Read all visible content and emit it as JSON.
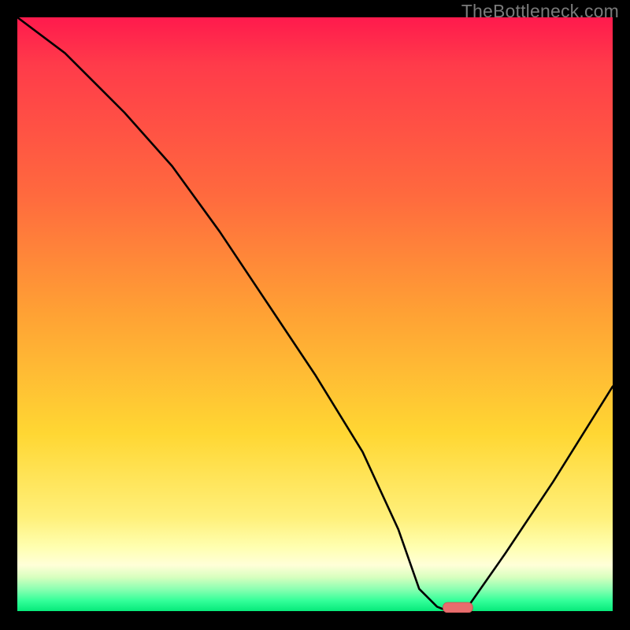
{
  "watermark": "TheBottleneck.com",
  "chart_data": {
    "type": "line",
    "title": "",
    "xlabel": "",
    "ylabel": "",
    "xlim": [
      0,
      100
    ],
    "ylim": [
      0,
      100
    ],
    "grid": false,
    "legend": false,
    "series": [
      {
        "name": "bottleneck-curve",
        "x": [
          0,
          8,
          18,
          26,
          34,
          42,
          50,
          58,
          64,
          67.5,
          70.5,
          73,
          75,
          82,
          90,
          100
        ],
        "values": [
          100,
          94,
          84,
          75,
          64,
          52,
          40,
          27,
          14,
          4,
          1,
          0,
          0,
          10,
          22,
          38
        ]
      }
    ],
    "marker": {
      "name": "optimal-marker",
      "x": 74,
      "y": 0,
      "width": 5,
      "color": "#e86d6d"
    },
    "gradient_stops": [
      {
        "pos": 0,
        "color": "#ff1a4d"
      },
      {
        "pos": 30,
        "color": "#ff6a3e"
      },
      {
        "pos": 50,
        "color": "#ffa234"
      },
      {
        "pos": 70,
        "color": "#ffd733"
      },
      {
        "pos": 90,
        "color": "#ffffb0"
      },
      {
        "pos": 96,
        "color": "#8dffb2"
      },
      {
        "pos": 100,
        "color": "#00e676"
      }
    ]
  }
}
